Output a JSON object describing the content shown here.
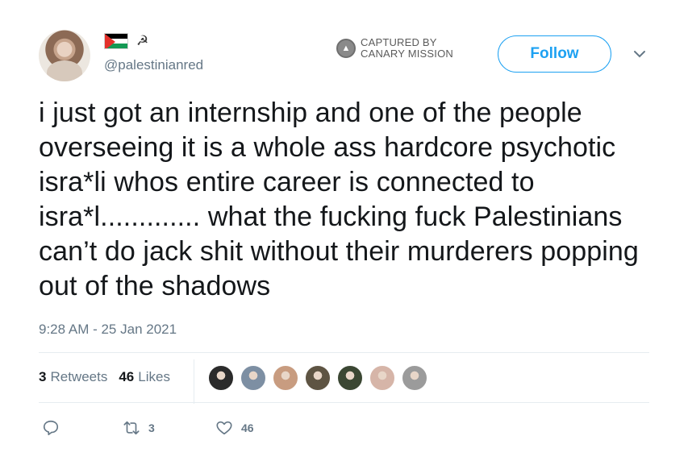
{
  "tweet": {
    "display_name_emoji": "☭",
    "handle": "@palestinianred",
    "text": "i just got an internship and one of the people overseeing it is a whole ass hardcore psychotic isra*li whos entire career is connected to isra*l............. what the fucking fuck Palestinians can’t do jack shit without their murderers popping out of the shadows",
    "timestamp": "9:28 AM - 25 Jan 2021"
  },
  "watermark": {
    "line1": "CAPTURED BY",
    "line2": "CANARY MISSION"
  },
  "follow_label": "Follow",
  "stats": {
    "retweets_count": "3",
    "retweets_label": "Retweets",
    "likes_count": "46",
    "likes_label": "Likes"
  },
  "liker_avatars": [
    {
      "color": "#2b2b2b"
    },
    {
      "color": "#7d8fa3"
    },
    {
      "color": "#c89c80"
    },
    {
      "color": "#5e5443"
    },
    {
      "color": "#3b4733"
    },
    {
      "color": "#d6b5a8"
    },
    {
      "color": "#9b9b9b"
    }
  ],
  "actions": {
    "reply_count": "",
    "retweet_count": "3",
    "like_count": "46"
  },
  "colors": {
    "accent": "#1da1f2",
    "muted": "#657786",
    "text": "#14171a"
  }
}
